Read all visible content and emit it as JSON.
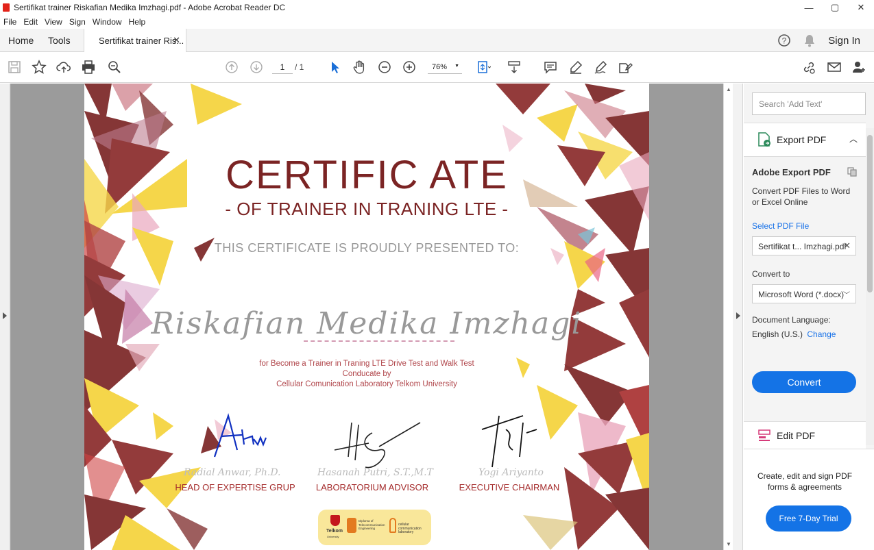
{
  "window": {
    "title": "Sertifikat trainer Riskafian Medika Imzhagi.pdf - Adobe Acrobat Reader DC",
    "controls": [
      "minimize-icon",
      "maximize-icon",
      "close-icon"
    ]
  },
  "menu": [
    "File",
    "Edit",
    "View",
    "Sign",
    "Window",
    "Help"
  ],
  "tabs": {
    "home": "Home",
    "tools": "Tools",
    "doc": "Sertifikat trainer Ris...",
    "sign_in": "Sign In"
  },
  "toolbar": {
    "page_current": "1",
    "page_total": "/ 1",
    "zoom": "76%"
  },
  "right_panel": {
    "search_placeholder": "Search 'Add Text'",
    "export_header": "Export PDF",
    "export_title": "Adobe Export PDF",
    "export_desc_1": "Convert PDF Files to Word",
    "export_desc_2": "or Excel Online",
    "select_file": "Select PDF File",
    "file_name": "Sertifikat t... Imzhagi.pdf",
    "convert_to": "Convert to",
    "format": "Microsoft Word (*.docx)",
    "doc_lang_label": "Document Language:",
    "doc_lang": "English (U.S.)",
    "change": "Change",
    "convert": "Convert",
    "edit_pdf": "Edit PDF",
    "promo_1": "Create, edit and sign PDF",
    "promo_2": "forms & agreements",
    "trial": "Free 7-Day Trial"
  },
  "certificate": {
    "title": "CERTIFIC ATE",
    "subtitle": "- OF TRAINER IN TRANING LTE -",
    "presented": "THIS CERTIFICATE IS PROUDLY PRESENTED TO:",
    "name": "Riskafian Medika Imzhagi",
    "desc_1": "for Become  a Trainer in Traning LTE Drive Test and Walk Test",
    "desc_2": "Conducate by",
    "desc_3": "Cellular Comunication Laboratory Telkom University",
    "signatories": [
      {
        "name": "Radial Anwar, Ph.D.",
        "role": "HEAD OF EXPERTISE GRUP"
      },
      {
        "name": "Hasanah Putri, S.T.,M.T",
        "role": "LABORATORIUM ADVISOR"
      },
      {
        "name": "Yogi Ariyanto",
        "role": "EXECUTIVE CHAIRMAN"
      }
    ],
    "logos": {
      "telkom": "Telkom",
      "telkom_sub": "University",
      "d3_1": "Diploma of",
      "d3_2": "Telecommunication",
      "d3_3": "Engineering",
      "cell_1": "cellular",
      "cell_2": "communication",
      "cell_3": "laboratory"
    },
    "colors": {
      "primary": "#7b2424",
      "accent": "#f5d33a",
      "pink": "#e8a0b8"
    }
  }
}
